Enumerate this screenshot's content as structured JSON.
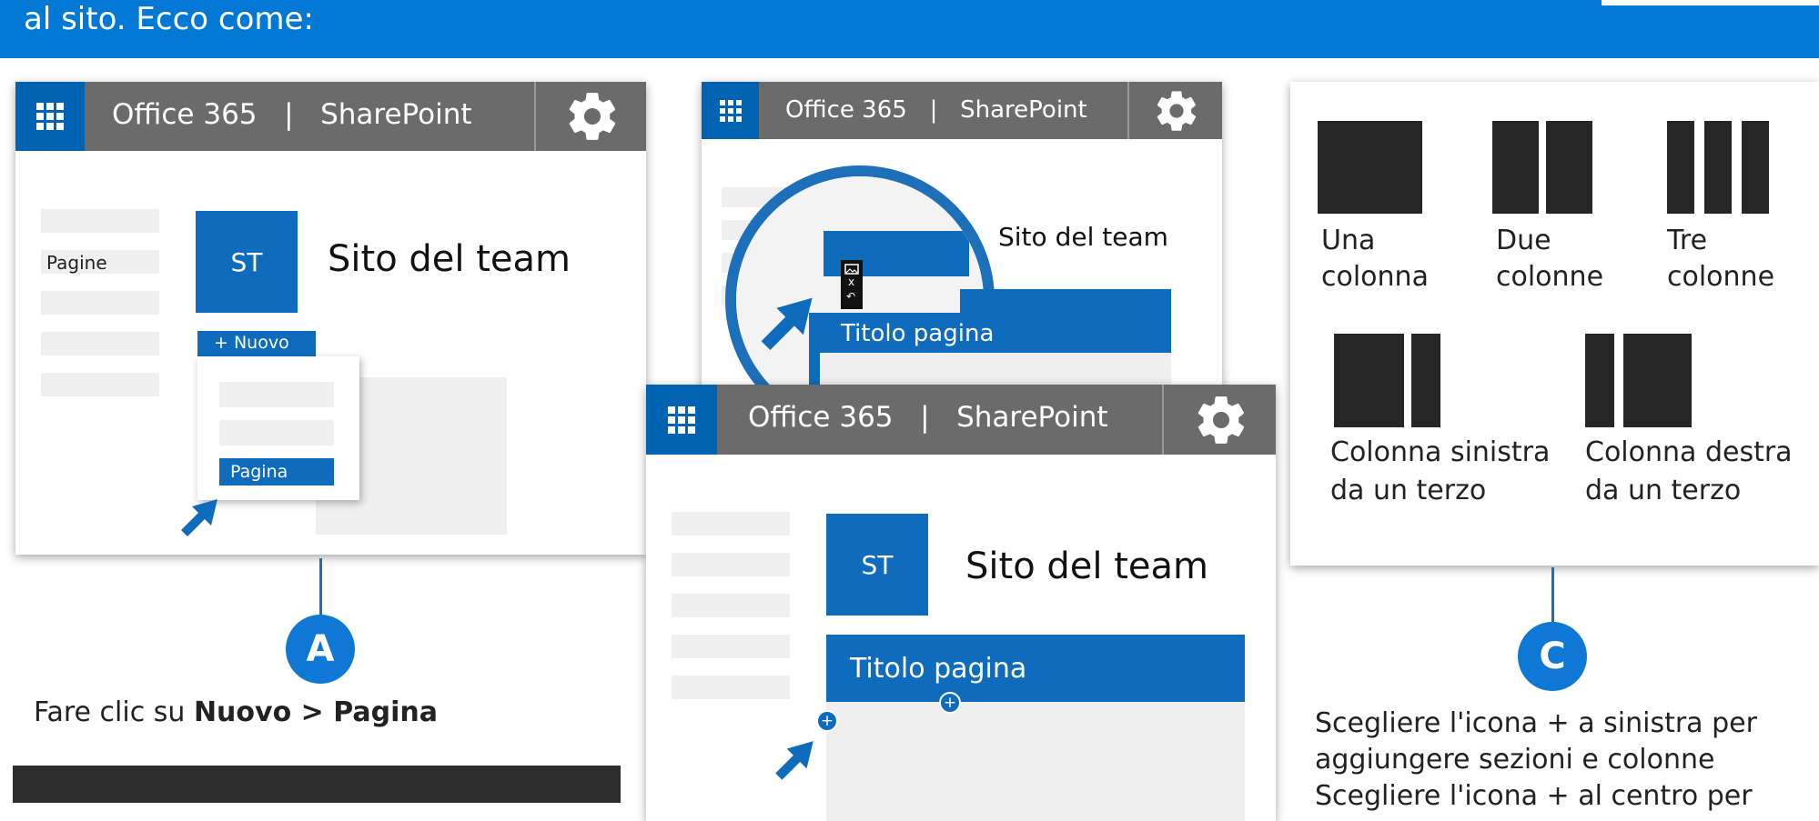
{
  "banner": {
    "text": "al sito. Ecco come:"
  },
  "app_bar": {
    "title": "Office 365   |   SharePoint"
  },
  "panel_a": {
    "nav_item": "Pagine",
    "tile": "ST",
    "site_title": "Sito del team",
    "new_button": "+ Nuovo",
    "menu_item": "Pagina"
  },
  "panel_b": {
    "site_title": "Sito del team",
    "page_title": "Titolo pagina",
    "toolbar_close": "x",
    "toolbar_undo": "↶"
  },
  "panel_c": {
    "tile": "ST",
    "site_title": "Sito del team",
    "page_title": "Titolo pagina",
    "plus": "+"
  },
  "step_a": {
    "letter": "A",
    "caption_prefix": "Fare clic su ",
    "caption_bold": "Nuovo > Pagina"
  },
  "step_c": {
    "letter": "C",
    "caption_lines": [
      "Scegliere l'icona + a sinistra per",
      "aggiungere sezioni e colonne",
      "Scegliere l'icona + al centro per"
    ]
  },
  "layouts": [
    {
      "line1": "Una",
      "line2": "colonna"
    },
    {
      "line1": "Due",
      "line2": "colonne"
    },
    {
      "line1": "Tre",
      "line2": "colonne"
    },
    {
      "line1": "Colonna sinistra",
      "line2": "da un terzo"
    },
    {
      "line1": "Colonna destra",
      "line2": "da un terzo"
    }
  ],
  "colors": {
    "accent": "#0078d4",
    "tile": "#0f6cbd",
    "bar": "#6b6b6b",
    "layout": "#262626"
  }
}
